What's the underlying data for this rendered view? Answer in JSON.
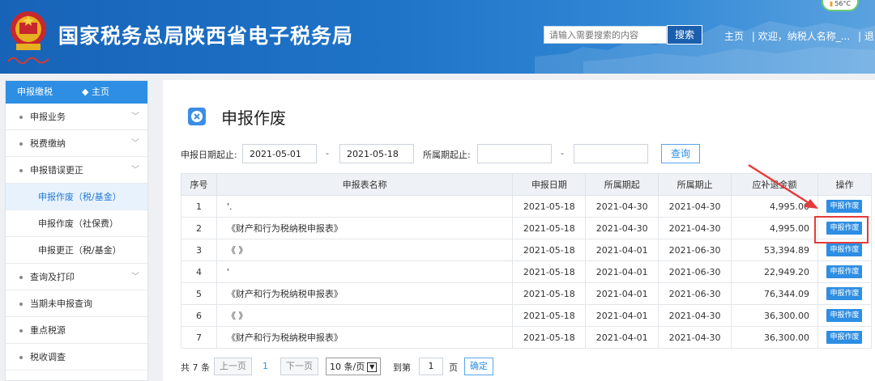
{
  "header": {
    "title": "国家税务总局陕西省电子税务局",
    "search_placeholder": "请输入需要搜索的内容",
    "search_button": "搜索",
    "home_link": "主页",
    "welcome": "| 欢迎，纳税人名称_...",
    "logout_sep": "| 退",
    "weather": "56°C",
    "brand_color": "#1f74c8"
  },
  "sidebar": {
    "header_label": "申报缴税",
    "home_label": "◆ 主页",
    "items": [
      {
        "label": "申报业务",
        "type": "group",
        "chevron": "﹀"
      },
      {
        "label": "税费缴纳",
        "type": "group",
        "chevron": "﹀"
      },
      {
        "label": "申报错误更正",
        "type": "group",
        "chevron": "﹀"
      },
      {
        "label": "申报作废（税/基金）",
        "type": "sub-active"
      },
      {
        "label": "申报作废（社保费）",
        "type": "sub"
      },
      {
        "label": "申报更正（税/基金）",
        "type": "sub"
      },
      {
        "label": "查询及打印",
        "type": "group",
        "chevron": "﹀"
      },
      {
        "label": "当期未申报查询",
        "type": "group"
      },
      {
        "label": "重点税源",
        "type": "group"
      },
      {
        "label": "税收调查",
        "type": "group"
      }
    ]
  },
  "main": {
    "title": "申报作废",
    "filter": {
      "date_from_label": "申报日期起止:",
      "date_from": "2021-05-01",
      "date_sep": "-",
      "date_to": "2021-05-18",
      "period_label": "所属期起止:",
      "period_from": "",
      "period_sep": "-",
      "period_to": "",
      "query_button": "查询"
    },
    "table": {
      "headers": [
        "序号",
        "申报表名称",
        "申报日期",
        "所属期起",
        "所属期止",
        "应补退金额",
        "操作"
      ],
      "rows": [
        [
          "1",
          "'.",
          "2021-05-18",
          "2021-04-30",
          "2021-04-30",
          "4,995.00",
          "申报作废"
        ],
        [
          "2",
          "《财产和行为税纳税申报表》",
          "2021-05-18",
          "2021-04-30",
          "2021-04-30",
          "4,995.00",
          "申报作废"
        ],
        [
          "3",
          "《                                               》",
          "2021-05-18",
          "2021-04-01",
          "2021-06-30",
          "53,394.89",
          "申报作废"
        ],
        [
          "4",
          "'",
          "2021-05-18",
          "2021-04-01",
          "2021-06-30",
          "22,949.20",
          "申报作废"
        ],
        [
          "5",
          "《财产和行为税纳税申报表》",
          "2021-05-18",
          "2021-04-01",
          "2021-06-30",
          "76,344.09",
          "申报作废"
        ],
        [
          "6",
          "《                        》",
          "2021-05-18",
          "2021-04-01",
          "2021-04-30",
          "36,300.00",
          "申报作废"
        ],
        [
          "7",
          "《财产和行为税纳税申报表》",
          "2021-05-18",
          "2021-04-01",
          "2021-04-30",
          "36,300.00",
          "申报作废"
        ]
      ]
    },
    "pager": {
      "total": "共 7 条",
      "prev": "上一页",
      "page": "1",
      "next": "下一页",
      "page_size": "10 条/页",
      "goto_label": "到第",
      "goto_value": "1",
      "page_unit": "页",
      "confirm": "确定"
    }
  }
}
